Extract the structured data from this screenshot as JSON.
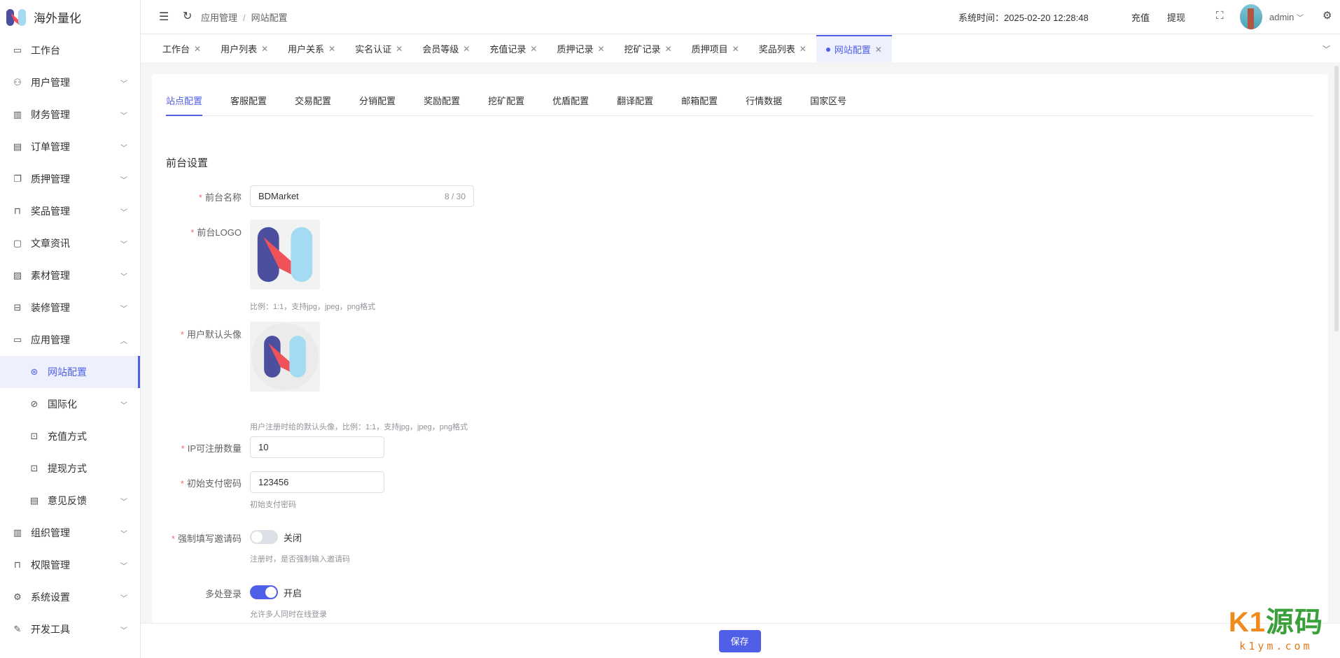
{
  "app": {
    "name": "海外量化"
  },
  "sidebar": {
    "items": [
      {
        "label": "工作台",
        "icon": "monitor-icon",
        "glyph": "▭"
      },
      {
        "label": "用户管理",
        "icon": "user-icon",
        "glyph": "⚇",
        "chev": "﹀"
      },
      {
        "label": "财务管理",
        "icon": "chart-icon",
        "glyph": "▥",
        "chev": "﹀"
      },
      {
        "label": "订单管理",
        "icon": "order-icon",
        "glyph": "▤",
        "chev": "﹀"
      },
      {
        "label": "质押管理",
        "icon": "pledge-icon",
        "glyph": "❐",
        "chev": "﹀"
      },
      {
        "label": "奖品管理",
        "icon": "bag-icon",
        "glyph": "⊓",
        "chev": "﹀"
      },
      {
        "label": "文章资讯",
        "icon": "article-icon",
        "glyph": "▢",
        "chev": "﹀"
      },
      {
        "label": "素材管理",
        "icon": "image-icon",
        "glyph": "▨",
        "chev": "﹀"
      },
      {
        "label": "装修管理",
        "icon": "decorate-icon",
        "glyph": "⊟",
        "chev": "﹀"
      },
      {
        "label": "应用管理",
        "icon": "app-icon",
        "glyph": "▭",
        "chev": "︿"
      },
      {
        "label": "网站配置",
        "icon": "globe-icon",
        "glyph": "⊛",
        "sub": true,
        "active": true
      },
      {
        "label": "国际化",
        "icon": "i18n-icon",
        "glyph": "⊘",
        "sub": true,
        "chev": "﹀"
      },
      {
        "label": "充值方式",
        "icon": "wallet-icon",
        "glyph": "⊡",
        "sub": true
      },
      {
        "label": "提现方式",
        "icon": "folder-icon",
        "glyph": "⊡",
        "sub": true
      },
      {
        "label": "意见反馈",
        "icon": "feedback-icon",
        "glyph": "▤",
        "sub": true,
        "chev": "﹀"
      },
      {
        "label": "组织管理",
        "icon": "building-icon",
        "glyph": "▥",
        "chev": "﹀"
      },
      {
        "label": "权限管理",
        "icon": "lock-icon",
        "glyph": "⊓",
        "chev": "﹀"
      },
      {
        "label": "系统设置",
        "icon": "gear-icon",
        "glyph": "⚙",
        "chev": "﹀"
      },
      {
        "label": "开发工具",
        "icon": "pen-icon",
        "glyph": "✎",
        "chev": "﹀"
      }
    ]
  },
  "header": {
    "breadcrumb": [
      "应用管理",
      "网站配置"
    ],
    "breadcrumb_sep": "/",
    "system_time": "系统时间：2025-02-20 12:28:48",
    "recharge": "充值",
    "withdraw": "提现",
    "user": "admin"
  },
  "tabs": [
    {
      "label": "工作台"
    },
    {
      "label": "用户列表"
    },
    {
      "label": "用户关系"
    },
    {
      "label": "实名认证"
    },
    {
      "label": "会员等级"
    },
    {
      "label": "充值记录"
    },
    {
      "label": "质押记录"
    },
    {
      "label": "挖矿记录"
    },
    {
      "label": "质押项目"
    },
    {
      "label": "奖品列表"
    },
    {
      "label": "网站配置",
      "active": true
    }
  ],
  "inner_tabs": [
    "站点配置",
    "客服配置",
    "交易配置",
    "分销配置",
    "奖励配置",
    "挖矿配置",
    "优盾配置",
    "翻译配置",
    "邮箱配置",
    "行情数据",
    "国家区号"
  ],
  "form": {
    "section": "前台设置",
    "site_name": {
      "label": "前台名称",
      "value": "BDMarket",
      "count": "8 / 30"
    },
    "logo": {
      "label": "前台LOGO",
      "hint": "比例：1:1，支持jpg，jpeg，png格式"
    },
    "avatar": {
      "label": "用户默认头像",
      "hint": "用户注册时给的默认头像，比例：1:1，支持jpg，jpeg，png格式"
    },
    "ip_limit": {
      "label": "IP可注册数量",
      "value": "10"
    },
    "pay_pwd": {
      "label": "初始支付密码",
      "value": "123456",
      "hint": "初始支付密码"
    },
    "invite": {
      "label": "强制填写邀请码",
      "state": "关闭",
      "on": false,
      "hint": "注册时，是否强制输入邀请码"
    },
    "multi_login": {
      "label": "多处登录",
      "state": "开启",
      "on": true,
      "hint": "允许多人同时在线登录"
    }
  },
  "footer": {
    "save": "保存"
  },
  "watermark": {
    "brand_k": "K1",
    "brand_cn": "源码",
    "site": "k1ym.com"
  },
  "colors": {
    "accent": "#4f5fe8",
    "required": "#f56c6c"
  }
}
